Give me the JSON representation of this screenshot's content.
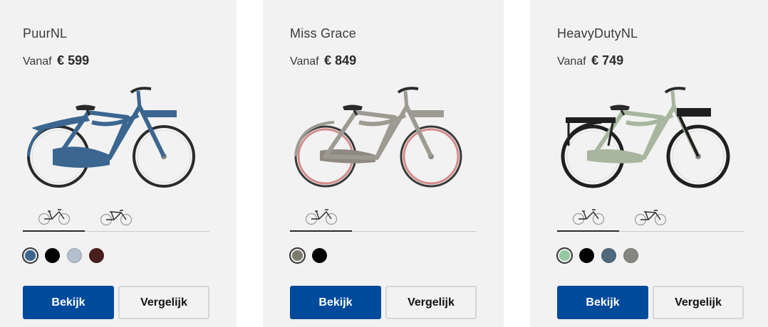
{
  "products": [
    {
      "name": "PuurNL",
      "price_prefix": "Vanaf",
      "price": "€ 599",
      "bike_image": "blue transport bike with front carrier and rear rack",
      "frame_tabs": [
        {
          "icon": "gent-frame-icon"
        },
        {
          "icon": "lady-frame-icon"
        }
      ],
      "colors": [
        "#3b6690",
        "#000000",
        "#b4bfcf",
        "#4a1e1c"
      ],
      "selected_color": "#3b6690",
      "buttons": {
        "view": "Bekijk",
        "compare": "Vergelijk"
      }
    },
    {
      "name": "Miss Grace",
      "price_prefix": "Vanaf",
      "price": "€ 849",
      "bike_image": "grey-beige transport bike with front carrier and pink tires",
      "frame_tabs": [
        {
          "icon": "gent-frame-icon"
        }
      ],
      "colors": [
        "#7c7b6d",
        "#000000"
      ],
      "selected_color": "#7c7b6d",
      "buttons": {
        "view": "Bekijk",
        "compare": "Vergelijk"
      }
    },
    {
      "name": "HeavyDutyNL",
      "price_prefix": "Vanaf",
      "price": "€ 749",
      "bike_image": "sage green transport bike with front and rear carrier",
      "frame_tabs": [
        {
          "icon": "gent-frame-icon"
        },
        {
          "icon": "lady-frame-icon"
        }
      ],
      "colors": [
        "#93c8a0",
        "#000000",
        "#4f6a7e",
        "#858881"
      ],
      "selected_color": "#93c8a0",
      "buttons": {
        "view": "Bekijk",
        "compare": "Vergelijk"
      }
    }
  ],
  "theme": {
    "accent": "#004a9c",
    "card_bg": "#f2f2f2"
  }
}
